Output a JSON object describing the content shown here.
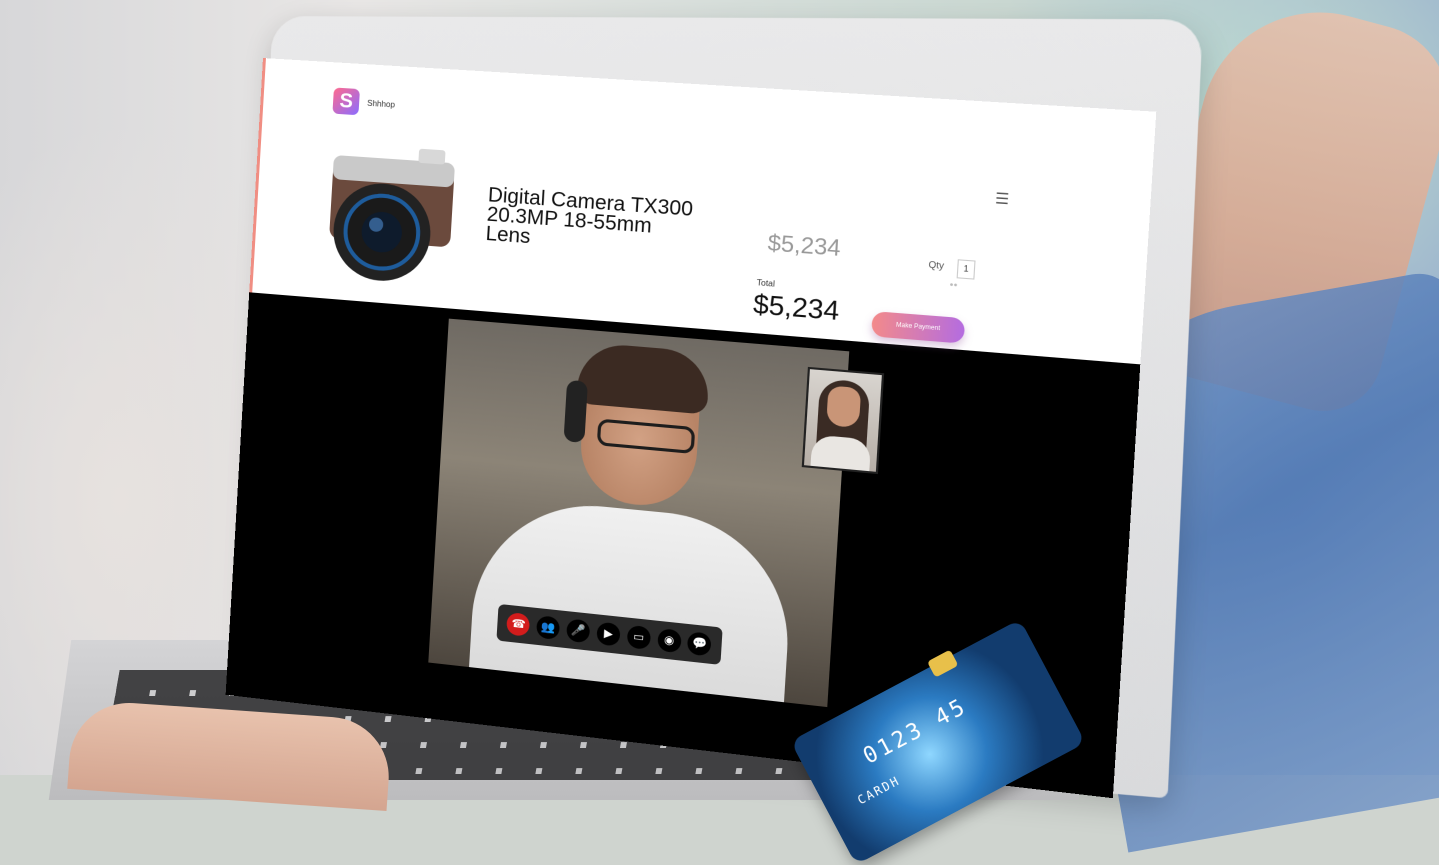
{
  "shop": {
    "brand": "Shhhop",
    "menu_icon": "☰",
    "product_title": "Digital Camera TX300 20.3MP 18-55mm Lens",
    "price": "$5,234",
    "total_label": "Total",
    "total_value": "$5,234",
    "qty_label": "Qty",
    "qty_value": "1",
    "pay_button": "Make Payment"
  },
  "call_controls": [
    {
      "icon": "end-call-icon",
      "glyph": "☎"
    },
    {
      "icon": "add-person-icon",
      "glyph": "👥"
    },
    {
      "icon": "microphone-icon",
      "glyph": "🎤"
    },
    {
      "icon": "video-camera-icon",
      "glyph": "▶"
    },
    {
      "icon": "screen-share-icon",
      "glyph": "▭"
    },
    {
      "icon": "snapshot-camera-icon",
      "glyph": "◉"
    },
    {
      "icon": "chat-icon",
      "glyph": "💬"
    }
  ],
  "card": {
    "number_fragment": "0123 45",
    "label_fragment": "CARDH"
  },
  "colors": {
    "button_gradient_start": "#f38a8a",
    "button_gradient_end": "#b46ce0",
    "end_call": "#d31c1c",
    "logo_gradient": [
      "#ff6a8e",
      "#8b6cff"
    ]
  }
}
